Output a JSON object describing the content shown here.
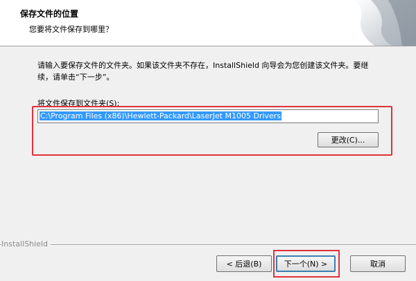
{
  "header": {
    "title": "保存文件的位置",
    "subtitle": "您要将文件保存到哪里？"
  },
  "body": {
    "instruction": "请输入要保存文件的文件夹。如果该文件夹不存在，InstallShield 向导会为您创建该文件夹。要继续，请单击“下一步”。",
    "folder_label": "将文件保存到文件夹(S):",
    "folder_path": "C:\\Program Files (x86)\\Hewlett-Packard\\LaserJet M1005 Drivers",
    "change_button": "更改(C)..."
  },
  "footer": {
    "brand": "InstallShield",
    "back_button": "< 后退(B)",
    "next_button": "下一个(N) >",
    "cancel_button": "取消"
  },
  "colors": {
    "highlight": "#e0313a",
    "selection": "#3399ff"
  }
}
